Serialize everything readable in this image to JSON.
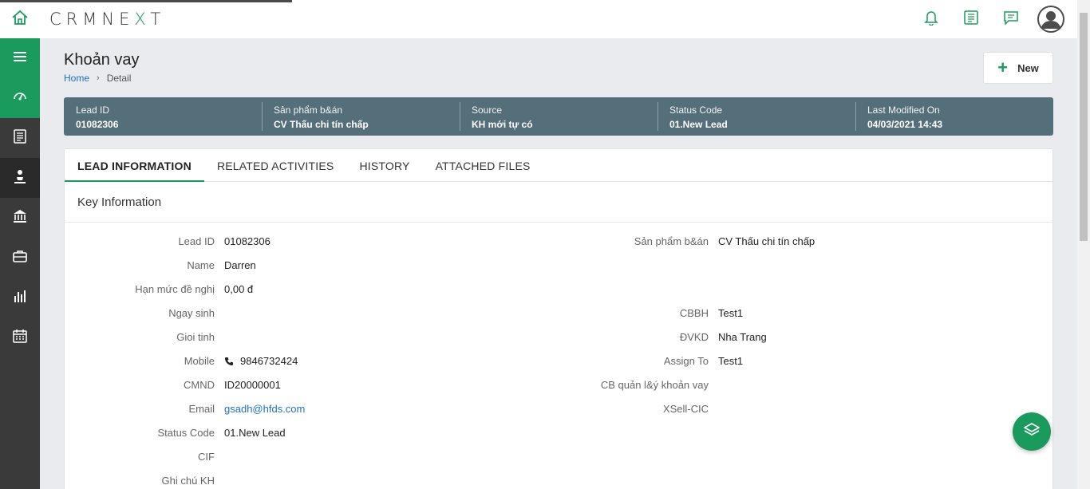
{
  "app": {
    "logo_pre": "CRMNE",
    "logo_x": "X",
    "logo_post": "T"
  },
  "colors": {
    "brand_green": "#1a9a5c",
    "summary_bg": "#546e7a",
    "sidebar_bg": "#3a3a3a",
    "link_blue": "#1f6fc5"
  },
  "topbar": {
    "icons": [
      "bell-icon",
      "notes-icon",
      "chat-icon",
      "user-avatar"
    ]
  },
  "sidebar": {
    "items": [
      "menu-icon",
      "dashboard-icon",
      "document-icon",
      "person-icon",
      "bank-icon",
      "briefcase-icon",
      "report-icon",
      "calendar-icon"
    ]
  },
  "page": {
    "title": "Khoản vay",
    "breadcrumb": {
      "home": "Home",
      "current": "Detail"
    },
    "new_button": "New"
  },
  "summary": {
    "lead_id": {
      "label": "Lead ID",
      "value": "01082306"
    },
    "product": {
      "label": "Sản phẩm b&án",
      "value": "CV Thấu chi tín chấp"
    },
    "source": {
      "label": "Source",
      "value": "KH mới tự có"
    },
    "status": {
      "label": "Status Code",
      "value": "01.New Lead"
    },
    "modified": {
      "label": "Last Modified On",
      "value": "04/03/2021 14:43"
    }
  },
  "tabs": [
    "LEAD INFORMATION",
    "RELATED ACTIVITIES",
    "HISTORY",
    "ATTACHED FILES"
  ],
  "section_title": "Key Information",
  "fields_left": [
    {
      "label": "Lead ID",
      "value": "01082306"
    },
    {
      "label": "Name",
      "value": "Darren"
    },
    {
      "label": "Hạn mức đề nghị",
      "value": "0,00 đ"
    },
    {
      "label": "Ngay sinh",
      "value": ""
    },
    {
      "label": "Gioi tinh",
      "value": ""
    },
    {
      "label": "Mobile",
      "value": "9846732424"
    },
    {
      "label": "CMND",
      "value": "ID20000001"
    },
    {
      "label": "Email",
      "value": "gsadh@hfds.com"
    },
    {
      "label": "Status Code",
      "value": "01.New Lead"
    },
    {
      "label": "CIF",
      "value": ""
    },
    {
      "label": "Ghi chú KH",
      "value": ""
    }
  ],
  "fields_right": [
    {
      "label": "Sản phẩm b&án",
      "value": "CV Thấu chi tín chấp"
    },
    {
      "label": "CBBH",
      "value": "Test1"
    },
    {
      "label": "ĐVKD",
      "value": "Nha Trang"
    },
    {
      "label": "Assign To",
      "value": "Test1"
    },
    {
      "label": "CB quản l&ý khoản vay",
      "value": ""
    },
    {
      "label": "XSell-CIC",
      "value": ""
    }
  ]
}
